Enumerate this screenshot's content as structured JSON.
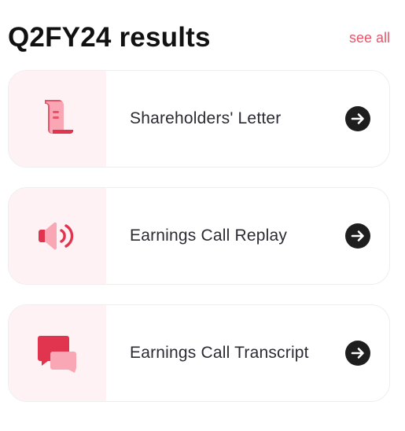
{
  "header": {
    "title": "Q2FY24 results",
    "see_all_label": "see all"
  },
  "cards": [
    {
      "label": "Shareholders' Letter",
      "icon": "scroll-document-icon"
    },
    {
      "label": "Earnings Call Replay",
      "icon": "speaker-volume-icon"
    },
    {
      "label": "Earnings Call Transcript",
      "icon": "chat-bubbles-icon"
    }
  ],
  "colors": {
    "accent": "#e5566b",
    "icon_bg": "#fff2f4",
    "title": "#111111",
    "text": "#2b2b33",
    "arrow": "#1e1e1e"
  }
}
